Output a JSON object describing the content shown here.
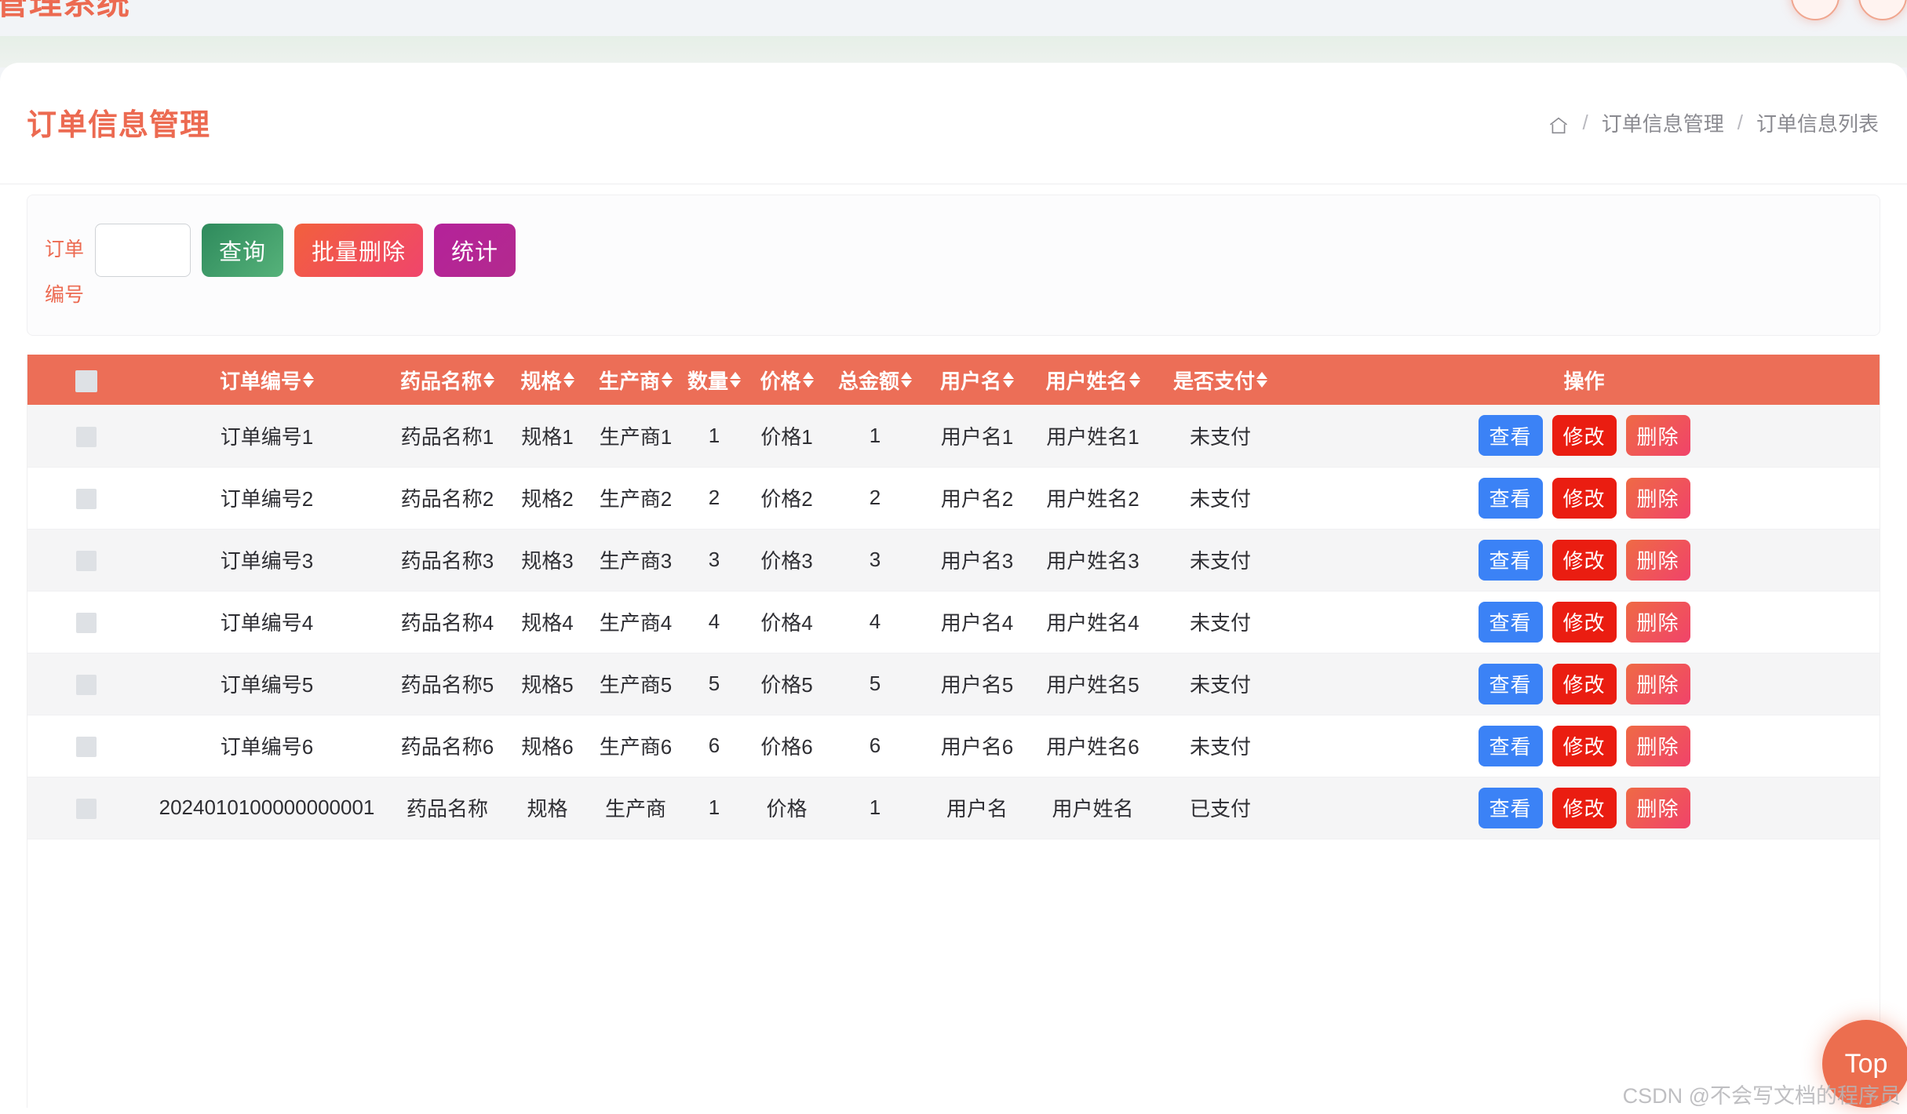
{
  "topbar": {
    "site_title": "管理系统",
    "avatar_1": "avatar-icon",
    "avatar_2": "avatar-icon"
  },
  "header": {
    "page_title": "订单信息管理",
    "breadcrumb": {
      "home_icon": "home-icon",
      "separator": "/",
      "items": [
        "订单信息管理",
        "订单信息列表"
      ]
    }
  },
  "filter": {
    "label": "订单编号",
    "input_value": "",
    "input_placeholder": "",
    "buttons": [
      {
        "label": "查询",
        "color": "#2e8a5c"
      },
      {
        "label": "批量删除",
        "color": "#f2603d"
      },
      {
        "label": "统计",
        "color": "#b4229a"
      }
    ]
  },
  "table": {
    "header_bg": "#ec6e57",
    "select_all": "checkbox",
    "columns": [
      {
        "label": "订单编号",
        "sortable": true
      },
      {
        "label": "药品名称",
        "sortable": true
      },
      {
        "label": "规格",
        "sortable": true
      },
      {
        "label": "生产商",
        "sortable": true
      },
      {
        "label": "数量",
        "sortable": true
      },
      {
        "label": "价格",
        "sortable": true
      },
      {
        "label": "总金额",
        "sortable": true
      },
      {
        "label": "用户名",
        "sortable": true
      },
      {
        "label": "用户姓名",
        "sortable": true
      },
      {
        "label": "是否支付",
        "sortable": true
      },
      {
        "label": "操作",
        "sortable": false
      }
    ],
    "row_actions": [
      {
        "label": "查看",
        "color": "#3b82f6"
      },
      {
        "label": "修改",
        "color": "#ea1d11"
      },
      {
        "label": "删除",
        "color": "#ef6a45"
      }
    ],
    "rows": [
      {
        "order_no": "订单编号1",
        "drug": "药品名称1",
        "spec": "规格1",
        "maker": "生产商1",
        "qty": "1",
        "price": "价格1",
        "total": "1",
        "username": "用户名1",
        "realname": "用户姓名1",
        "paid": "未支付"
      },
      {
        "order_no": "订单编号2",
        "drug": "药品名称2",
        "spec": "规格2",
        "maker": "生产商2",
        "qty": "2",
        "price": "价格2",
        "total": "2",
        "username": "用户名2",
        "realname": "用户姓名2",
        "paid": "未支付"
      },
      {
        "order_no": "订单编号3",
        "drug": "药品名称3",
        "spec": "规格3",
        "maker": "生产商3",
        "qty": "3",
        "price": "价格3",
        "total": "3",
        "username": "用户名3",
        "realname": "用户姓名3",
        "paid": "未支付"
      },
      {
        "order_no": "订单编号4",
        "drug": "药品名称4",
        "spec": "规格4",
        "maker": "生产商4",
        "qty": "4",
        "price": "价格4",
        "total": "4",
        "username": "用户名4",
        "realname": "用户姓名4",
        "paid": "未支付"
      },
      {
        "order_no": "订单编号5",
        "drug": "药品名称5",
        "spec": "规格5",
        "maker": "生产商5",
        "qty": "5",
        "price": "价格5",
        "total": "5",
        "username": "用户名5",
        "realname": "用户姓名5",
        "paid": "未支付"
      },
      {
        "order_no": "订单编号6",
        "drug": "药品名称6",
        "spec": "规格6",
        "maker": "生产商6",
        "qty": "6",
        "price": "价格6",
        "total": "6",
        "username": "用户名6",
        "realname": "用户姓名6",
        "paid": "未支付"
      },
      {
        "order_no": "2024010100000000001",
        "drug": "药品名称",
        "spec": "规格",
        "maker": "生产商",
        "qty": "1",
        "price": "价格",
        "total": "1",
        "username": "用户名",
        "realname": "用户姓名",
        "paid": "已支付"
      }
    ]
  },
  "back_to_top": {
    "label": "Top"
  },
  "watermark": {
    "text": "CSDN @不会写文档的程序员"
  }
}
